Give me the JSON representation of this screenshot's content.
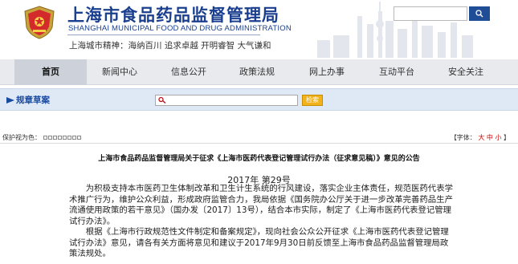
{
  "header": {
    "title_cn": "上海市食品药品监督管理局",
    "title_en": "SHANGHAI MUNICIPAL FOOD AND DRUG ADMINISTRATION",
    "slogan": "上海城市精神：海纳百川  追求卓越  开明睿智  大气谦和"
  },
  "nav": {
    "items": [
      {
        "label": "首页"
      },
      {
        "label": "新闻中心"
      },
      {
        "label": "信息公开"
      },
      {
        "label": "政策法规"
      },
      {
        "label": "网上办事"
      },
      {
        "label": "互动平台"
      },
      {
        "label": "安全关注"
      }
    ]
  },
  "reg_search": {
    "title": "规章草案",
    "button_label": "检索"
  },
  "position": {
    "label": "保护视为色：",
    "font_size_label": "【字体：",
    "large": "大",
    "medium": "中",
    "small": "小",
    "close": "】"
  },
  "article": {
    "title": "上海市食品药品监督管理局关于征求《上海市医药代表登记管理试行办法（征求意见稿）》意见的公告",
    "doc_no": "2017年  第29号",
    "para1": "为积极支持本市医药卫生体制改革和卫生计生系统的行风建设，落实企业主体责任，规范医药代表学术推广行为，维护公众利益，形成政府监管合力，我局依据《国务院办公厅关于进一步改革完善药品生产流通使用政策的若干意见》（国办发〔2017〕13号），结合本市实际，制定了《上海市医药代表登记管理试行办法》。",
    "para2": "根据《上海市行政规范性文件制定和备案规定》，现向社会公众公开征求《上海市医药代表登记管理试行办法》意见，请各有关方面将意见和建议于2017年9月30日前反馈至上海市食品药品监督管理局政策法规处。"
  },
  "colors": {
    "brand_blue": "#1a3f8f",
    "nav_bg": "#e8eaee",
    "search_button": "#1f4e96",
    "reg_button": "#f2b21b"
  }
}
